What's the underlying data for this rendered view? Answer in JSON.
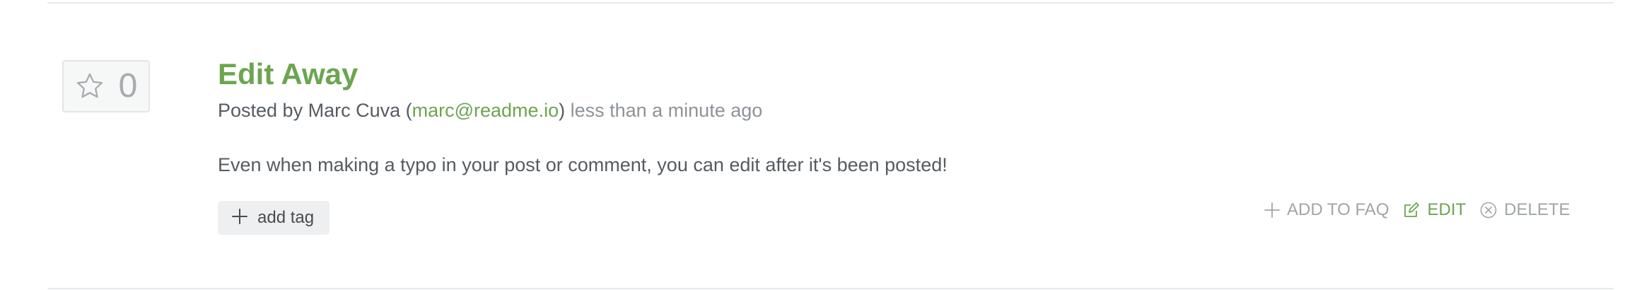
{
  "post": {
    "votes": "0",
    "title": "Edit Away",
    "meta": {
      "prefix": "Posted by ",
      "author": "Marc Cuva",
      "open_paren": " (",
      "email": "marc@readme.io",
      "close_paren": ")",
      "time": " less than a minute ago"
    },
    "body": "Even when making a typo in your post or comment, you can edit after it's been posted!"
  },
  "tags": {
    "add_label": "add tag"
  },
  "actions": {
    "add_to_faq": "ADD TO FAQ",
    "edit": "EDIT",
    "delete": "DELETE"
  },
  "colors": {
    "accent_green": "#6ca550",
    "muted_gray": "#a0a5aa",
    "text": "#555b61"
  },
  "icons": {
    "vote": "star-icon",
    "add_tag": "plus-icon",
    "add_to_faq": "plus-icon",
    "edit": "pencil-icon",
    "delete": "x-circle-icon"
  }
}
